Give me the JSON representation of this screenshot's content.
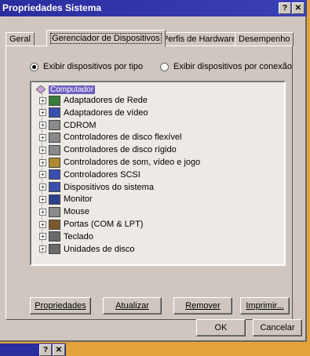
{
  "window": {
    "title": "Propriedades Sistema",
    "help_btn": "?",
    "close_btn": "✕"
  },
  "tabs": [
    {
      "label": "Geral"
    },
    {
      "label": "Gerenciador de Dispositivos"
    },
    {
      "label": "Perfis de Hardware"
    },
    {
      "label": "Desempenho"
    }
  ],
  "view_options": {
    "by_type": "Exibir dispositivos por tipo",
    "by_connection": "Exibir dispositivos por conexão",
    "selected": "by_type"
  },
  "tree": {
    "root": "Computador",
    "items": [
      {
        "label": "Adaptadores de Rede",
        "icon": "network-adapter-icon",
        "color": "#3a7d3a"
      },
      {
        "label": "Adaptadores de vídeo",
        "icon": "display-adapter-icon",
        "color": "#3b4fb0"
      },
      {
        "label": "CDROM",
        "icon": "cdrom-icon",
        "color": "#8a8a8a"
      },
      {
        "label": "Controladores de disco flexível",
        "icon": "floppy-controller-icon",
        "color": "#8a8a8a"
      },
      {
        "label": "Controladores de disco rígido",
        "icon": "hard-disk-controller-icon",
        "color": "#8a8a8a"
      },
      {
        "label": "Controladores de som, vídeo e jogo",
        "icon": "sound-controller-icon",
        "color": "#b08a2e"
      },
      {
        "label": "Controladores SCSI",
        "icon": "scsi-controller-icon",
        "color": "#3b4fb0"
      },
      {
        "label": "Dispositivos do sistema",
        "icon": "system-device-icon",
        "color": "#3b4fb0"
      },
      {
        "label": "Monitor",
        "icon": "monitor-icon",
        "color": "#2e3f8f"
      },
      {
        "label": "Mouse",
        "icon": "mouse-icon",
        "color": "#8a8a8a"
      },
      {
        "label": "Portas (COM & LPT)",
        "icon": "port-icon",
        "color": "#7a5a2a"
      },
      {
        "label": "Teclado",
        "icon": "keyboard-icon",
        "color": "#6a6a6a"
      },
      {
        "label": "Unidades de disco",
        "icon": "disk-drive-icon",
        "color": "#6a6a6a"
      }
    ]
  },
  "buttons": {
    "properties": "Propriedades",
    "refresh": "Atualizar",
    "remove": "Remover",
    "print": "Imprimir...",
    "ok": "OK",
    "cancel": "Cancelar"
  },
  "background_window": {
    "help_btn": "?",
    "close_btn": "✕"
  }
}
